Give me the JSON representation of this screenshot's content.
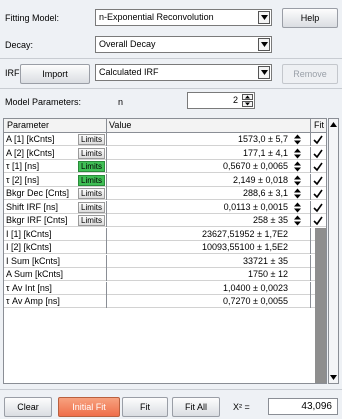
{
  "fitting_model": {
    "label": "Fitting Model:",
    "value": "n-Exponential Reconvolution",
    "help": "Help"
  },
  "decay": {
    "label": "Decay:",
    "value": "Overall Decay"
  },
  "irf": {
    "label": "IRF:",
    "import": "Import",
    "value": "Calculated IRF",
    "remove": "Remove"
  },
  "model_params": {
    "label": "Model Parameters:",
    "n_label": "n",
    "n_value": "2"
  },
  "grid": {
    "headers": {
      "parameter": "Parameter",
      "value": "Value",
      "fit": "Fit"
    },
    "limits_label": "Limits",
    "rows": [
      {
        "name": "A [1] [kCnts]",
        "value": "1573,0 ± 5,7",
        "limits_active": false
      },
      {
        "name": "A [2] [kCnts]",
        "value": "177,1 ± 4,1",
        "limits_active": false
      },
      {
        "name": "τ [1] [ns]",
        "value": "0,5670 ± 0,0065",
        "limits_active": true
      },
      {
        "name": "τ [2] [ns]",
        "value": "2,149 ± 0,018",
        "limits_active": true
      },
      {
        "name": "Bkgr Dec [Cnts]",
        "value": "288,6 ± 3,1",
        "limits_active": false
      },
      {
        "name": "Shift IRF [ns]",
        "value": "0,0113 ± 0,0015",
        "limits_active": false
      },
      {
        "name": "Bkgr IRF [Cnts]",
        "value": "258 ± 35",
        "limits_active": false
      }
    ],
    "derived": [
      {
        "name": "I [1] [kCnts]",
        "value": "23627,51952 ± 1,7E2"
      },
      {
        "name": "I [2] [kCnts]",
        "value": "10093,55100 ± 1,5E2"
      },
      {
        "name": "I Sum [kCnts]",
        "value": "33721 ± 35"
      },
      {
        "name": "A Sum [kCnts]",
        "value": "1750 ± 12"
      },
      {
        "name": "τ Av Int [ns]",
        "value": "1,0400 ± 0,0023"
      },
      {
        "name": "τ Av Amp [ns]",
        "value": "0,7270 ± 0,0055"
      }
    ]
  },
  "buttons": {
    "clear": "Clear",
    "initial_fit": "Initial Fit",
    "fit": "Fit",
    "fit_all": "Fit All"
  },
  "chi2": {
    "label": "X² =",
    "value": "43,096"
  },
  "colors": {
    "orange_button": "#ef6e4a",
    "limits_active": "#3fbf55"
  },
  "icons": [
    "dropdown-arrow-icon",
    "spin-up-icon",
    "spin-down-icon",
    "checkmark-icon",
    "scroll-up-icon",
    "scroll-down-icon"
  ]
}
